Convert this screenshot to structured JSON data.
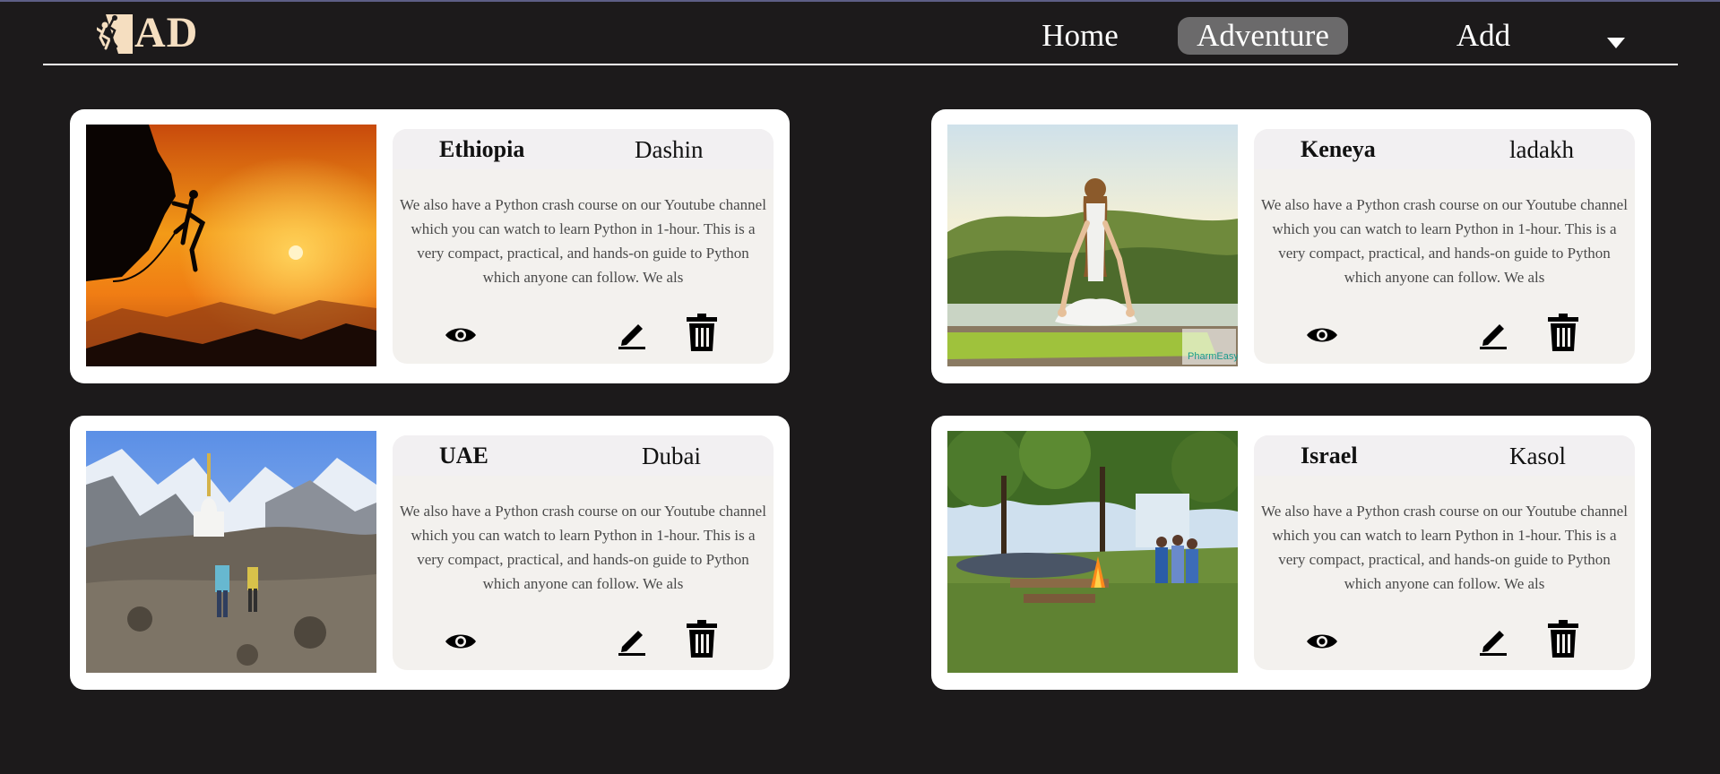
{
  "app": {
    "logo_text": "AD"
  },
  "nav": {
    "items": [
      {
        "label": "Home",
        "active": false
      },
      {
        "label": "Adventure",
        "active": true
      },
      {
        "label": "Add",
        "active": false
      }
    ]
  },
  "icons": {
    "logo": "climber-logo-icon",
    "view": "eye-icon",
    "edit": "pencil-icon",
    "delete": "trash-icon",
    "menu": "caret-down-icon"
  },
  "colors": {
    "background": "#1c1a1b",
    "logo": "#f5dec0",
    "active_nav": "#6b6a6b"
  },
  "cards": [
    {
      "country": "Ethiopia",
      "place": "Dashin",
      "image": "rock-climber-silhouette-sunset",
      "description": "We also have a Python crash course on our Youtube channel which you can watch to learn Python in 1-hour. This is a very compact, practical, and hands-on guide to Python which anyone can follow. We als"
    },
    {
      "country": "Keneya",
      "place": "ladakh",
      "image": "yoga-meditation-by-lake",
      "image_caption": "PharmEasy",
      "description": "We also have a Python crash course on our Youtube channel which you can watch to learn Python in 1-hour. This is a very compact, practical, and hands-on guide to Python which anyone can follow. We als"
    },
    {
      "country": "UAE",
      "place": "Dubai",
      "image": "himalayan-trek-with-stupa",
      "description": "We also have a Python crash course on our Youtube channel which you can watch to learn Python in 1-hour. This is a very compact, practical, and hands-on guide to Python which anyone can follow. We als"
    },
    {
      "country": "Israel",
      "place": "Kasol",
      "image": "campfire-gathering-in-woods",
      "description": "We also have a Python crash course on our Youtube channel which you can watch to learn Python in 1-hour. This is a very compact, practical, and hands-on guide to Python which anyone can follow. We als"
    }
  ]
}
